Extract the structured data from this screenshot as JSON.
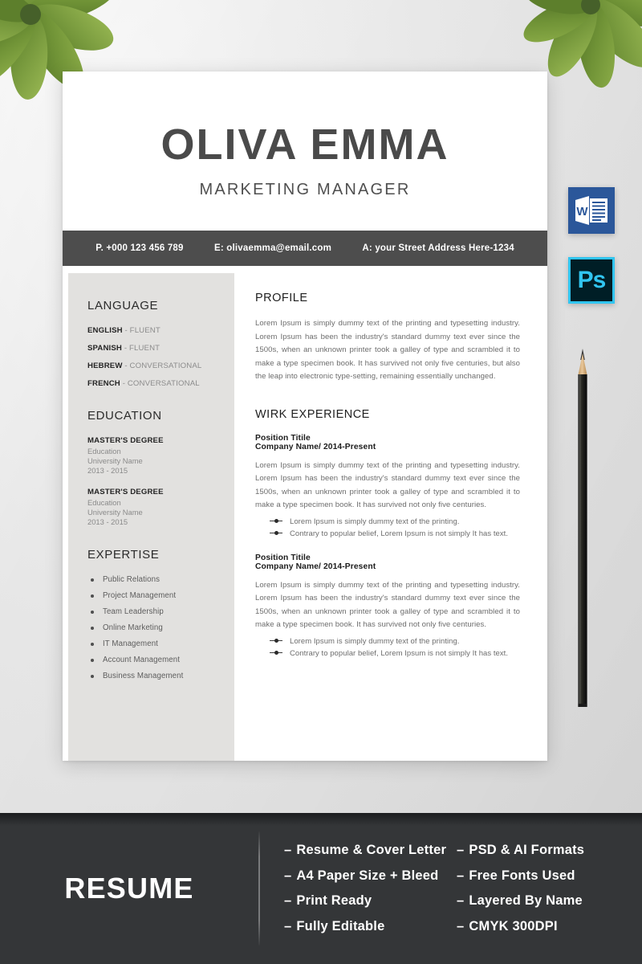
{
  "resume": {
    "name": "OLIVA EMMA",
    "job_title": "MARKETING MANAGER",
    "contact": {
      "phone": "P. +000 123 456 789",
      "email": "E: olivaemma@email.com",
      "address": "A: your Street Address Here-1234"
    },
    "sidebar": {
      "language": {
        "heading": "LANGUAGE",
        "items": [
          {
            "name": "ENGLISH",
            "level": " - FLUENT"
          },
          {
            "name": "SPANISH",
            "level": " - FLUENT"
          },
          {
            "name": "HEBREW",
            "level": " - CONVERSATIONAL"
          },
          {
            "name": "FRENCH",
            "level": " - CONVERSATIONAL"
          }
        ]
      },
      "education": {
        "heading": "EDUCATION",
        "items": [
          {
            "degree": "MASTER'S DEGREE",
            "field": "Education",
            "university": "University Name",
            "years": "2013 - 2015"
          },
          {
            "degree": "MASTER'S DEGREE",
            "field": "Education",
            "university": "University Name",
            "years": "2013 - 2015"
          }
        ]
      },
      "expertise": {
        "heading": "EXPERTISE",
        "items": [
          "Public Relations",
          "Project Management",
          "Team Leadership",
          "Online Marketing",
          "IT Management",
          "Account Management",
          "Business Management"
        ]
      }
    },
    "main": {
      "profile": {
        "heading": "PROFILE",
        "text": "Lorem Ipsum is simply dummy text of the printing and typesetting industry. Lorem Ipsum has been the industry's standard dummy text ever since the 1500s, when an unknown printer took a galley of type and scrambled it to make a type specimen book. It has survived not only five centuries, but also the leap into electronic type-setting, remaining essentially unchanged."
      },
      "experience": {
        "heading": "WIRK EXPERIENCE",
        "jobs": [
          {
            "position": "Position Titile",
            "company": "Company Name/ 2014-Present",
            "text": "Lorem Ipsum is simply dummy text of the printing and typesetting industry. Lorem Ipsum has been the industry's standard dummy text ever since the 1500s, when an unknown printer took a galley of type and scrambled it to make a type specimen book. It has survived not only five centuries.",
            "bullets": [
              "Lorem Ipsum is simply dummy text of the printing.",
              "Contrary to popular belief, Lorem Ipsum is not simply It has text."
            ]
          },
          {
            "position": "Position Titile",
            "company": "Company Name/ 2014-Present",
            "text": "Lorem Ipsum is simply dummy text of the printing and typesetting industry. Lorem Ipsum has been the industry's standard dummy text ever since the 1500s, when an unknown printer took a galley of type and scrambled it to make a type specimen book. It has survived not only five centuries.",
            "bullets": [
              "Lorem Ipsum is simply dummy text of the printing.",
              "Contrary to popular belief, Lorem Ipsum is not simply It has text."
            ]
          }
        ]
      }
    }
  },
  "format_icons": {
    "word": {
      "name": "word-icon",
      "letter": "W",
      "color": "#2B579A"
    },
    "photoshop": {
      "name": "photoshop-icon",
      "letter": "Ps",
      "color": "#31C5F0",
      "background": "#001E26"
    }
  },
  "banner": {
    "title": "RESUME",
    "background": "#343638",
    "dash": "–",
    "features_left": [
      "Resume & Cover Letter",
      "A4 Paper Size + Bleed",
      "Print Ready",
      "Fully Editable"
    ],
    "features_right": [
      "PSD & AI Formats",
      "Free Fonts Used",
      "Layered By Name",
      "CMYK 300DPI"
    ]
  }
}
